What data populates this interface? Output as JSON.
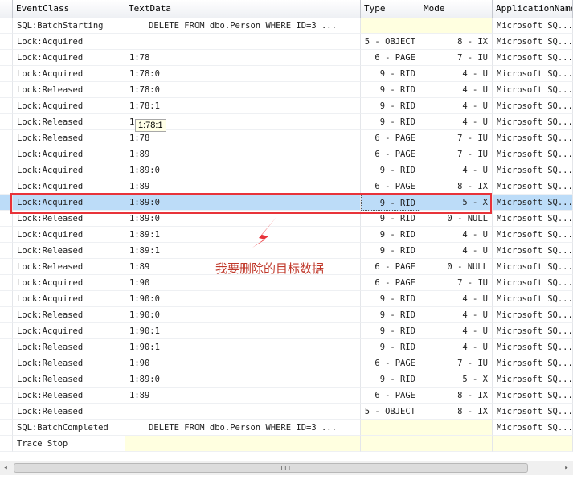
{
  "columns": {
    "event_class": "EventClass",
    "text_data": "TextData",
    "type": "Type",
    "mode": "Mode",
    "application_name": "ApplicationName"
  },
  "rows": [
    {
      "event": "SQL:BatchStarting",
      "text": "DELETE FROM dbo.Person WHERE ID=3  ...",
      "type": "",
      "mode": "",
      "app": "Microsoft SQ..."
    },
    {
      "event": "Lock:Acquired",
      "text": "",
      "type": "5 - OBJECT",
      "mode": "8 - IX",
      "app": "Microsoft SQ..."
    },
    {
      "event": "Lock:Acquired",
      "text": "1:78",
      "type": "6 - PAGE",
      "mode": "7 - IU",
      "app": "Microsoft SQ..."
    },
    {
      "event": "Lock:Acquired",
      "text": "1:78:0",
      "type": "9 - RID",
      "mode": "4 - U",
      "app": "Microsoft SQ..."
    },
    {
      "event": "Lock:Released",
      "text": "1:78:0",
      "type": "9 - RID",
      "mode": "4 - U",
      "app": "Microsoft SQ..."
    },
    {
      "event": "Lock:Acquired",
      "text": "1:78:1",
      "type": "9 - RID",
      "mode": "4 - U",
      "app": "Microsoft SQ..."
    },
    {
      "event": "Lock:Released",
      "text": "1",
      "type": "9 - RID",
      "mode": "4 - U",
      "app": "Microsoft SQ..."
    },
    {
      "event": "Lock:Released",
      "text": "1:78",
      "type": "6 - PAGE",
      "mode": "7 - IU",
      "app": "Microsoft SQ..."
    },
    {
      "event": "Lock:Acquired",
      "text": "1:89",
      "type": "6 - PAGE",
      "mode": "7 - IU",
      "app": "Microsoft SQ..."
    },
    {
      "event": "Lock:Acquired",
      "text": "1:89:0",
      "type": "9 - RID",
      "mode": "4 - U",
      "app": "Microsoft SQ..."
    },
    {
      "event": "Lock:Acquired",
      "text": "1:89",
      "type": "6 - PAGE",
      "mode": "8 - IX",
      "app": "Microsoft SQ..."
    },
    {
      "event": "Lock:Acquired",
      "text": "1:89:0",
      "type": "9 - RID",
      "mode": "5 - X",
      "app": "Microsoft SQ..."
    },
    {
      "event": "Lock:Released",
      "text": "1:89:0",
      "type": "9 - RID",
      "mode": "0 - NULL",
      "app": "Microsoft SQ..."
    },
    {
      "event": "Lock:Acquired",
      "text": "1:89:1",
      "type": "9 - RID",
      "mode": "4 - U",
      "app": "Microsoft SQ..."
    },
    {
      "event": "Lock:Released",
      "text": "1:89:1",
      "type": "9 - RID",
      "mode": "4 - U",
      "app": "Microsoft SQ..."
    },
    {
      "event": "Lock:Released",
      "text": "1:89",
      "type": "6 - PAGE",
      "mode": "0 - NULL",
      "app": "Microsoft SQ..."
    },
    {
      "event": "Lock:Acquired",
      "text": "1:90",
      "type": "6 - PAGE",
      "mode": "7 - IU",
      "app": "Microsoft SQ..."
    },
    {
      "event": "Lock:Acquired",
      "text": "1:90:0",
      "type": "9 - RID",
      "mode": "4 - U",
      "app": "Microsoft SQ..."
    },
    {
      "event": "Lock:Released",
      "text": "1:90:0",
      "type": "9 - RID",
      "mode": "4 - U",
      "app": "Microsoft SQ..."
    },
    {
      "event": "Lock:Acquired",
      "text": "1:90:1",
      "type": "9 - RID",
      "mode": "4 - U",
      "app": "Microsoft SQ..."
    },
    {
      "event": "Lock:Released",
      "text": "1:90:1",
      "type": "9 - RID",
      "mode": "4 - U",
      "app": "Microsoft SQ..."
    },
    {
      "event": "Lock:Released",
      "text": "1:90",
      "type": "6 - PAGE",
      "mode": "7 - IU",
      "app": "Microsoft SQ..."
    },
    {
      "event": "Lock:Released",
      "text": "1:89:0",
      "type": "9 - RID",
      "mode": "5 - X",
      "app": "Microsoft SQ..."
    },
    {
      "event": "Lock:Released",
      "text": "1:89",
      "type": "6 - PAGE",
      "mode": "8 - IX",
      "app": "Microsoft SQ..."
    },
    {
      "event": "Lock:Released",
      "text": "",
      "type": "5 - OBJECT",
      "mode": "8 - IX",
      "app": "Microsoft SQ..."
    },
    {
      "event": "SQL:BatchCompleted",
      "text": "DELETE FROM dbo.Person WHERE ID=3  ...",
      "type": "",
      "mode": "",
      "app": "Microsoft SQ..."
    },
    {
      "event": "Trace Stop",
      "text": "",
      "type": "",
      "mode": "",
      "app": ""
    }
  ],
  "selected_row": 11,
  "tooltip": "1:78:1",
  "annotation": "我要删除的目标数据",
  "colors": {
    "selection": "#bcdcf8",
    "highlight_border": "#e8333a",
    "annotation": "#c0392b",
    "empty_cell": "#ffffe0"
  },
  "scrollbar": {
    "left_arrow": "◂",
    "right_arrow": "▸",
    "grip": "III"
  }
}
